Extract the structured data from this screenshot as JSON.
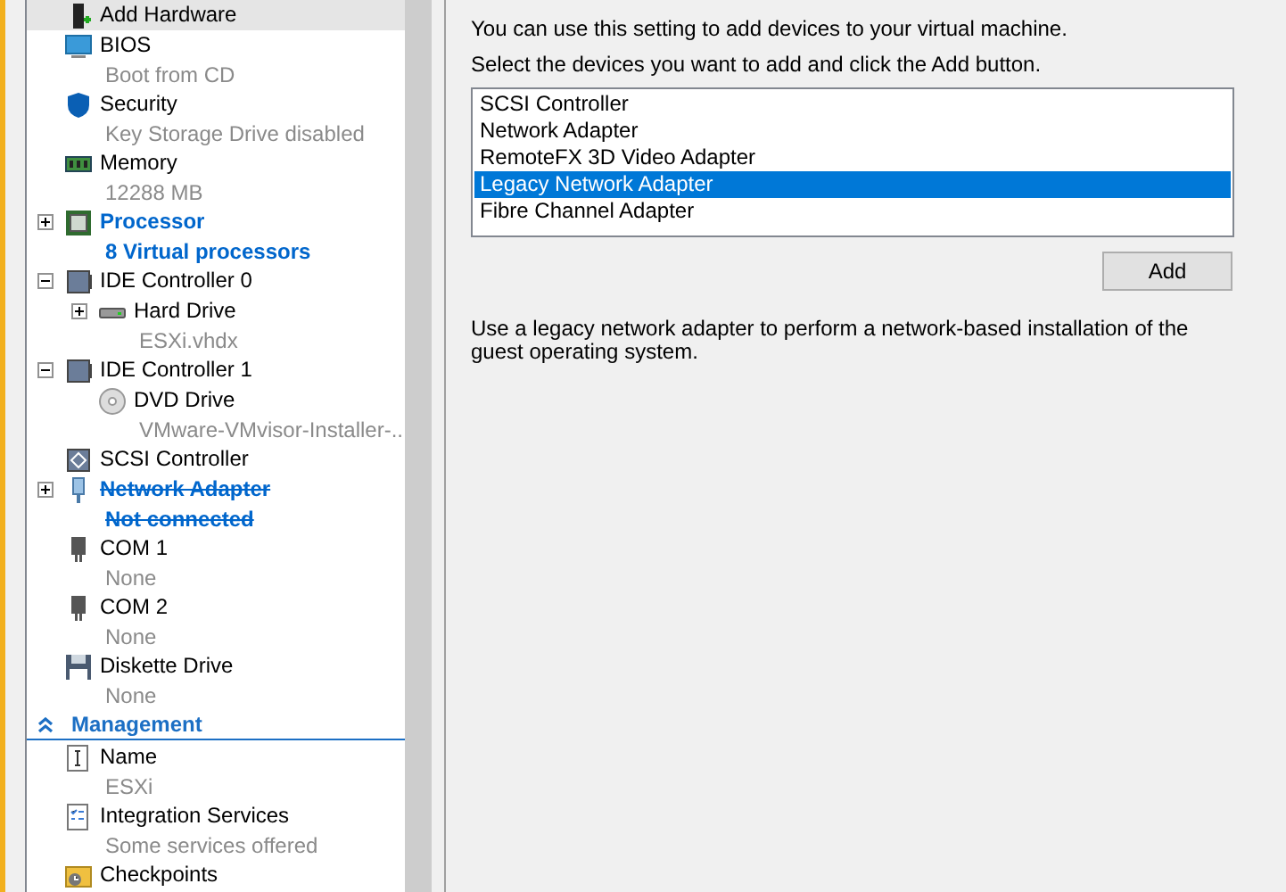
{
  "sidebar": {
    "sections": [
      {
        "items": [
          {
            "title": "Add Hardware",
            "selected": true
          },
          {
            "title": "BIOS",
            "subtitle": "Boot from CD",
            "selected": false
          },
          {
            "title": "Security",
            "subtitle": "Key Storage Drive disabled",
            "selected": false
          },
          {
            "title": "Memory",
            "subtitle": "12288 MB",
            "selected": false
          },
          {
            "title": "Processor",
            "subtitle": "8 Virtual processors",
            "selected": false,
            "emphasized": true,
            "expanded": false
          },
          {
            "title": "IDE Controller 0",
            "selected": false,
            "expanded": true,
            "children": [
              {
                "title": "Hard Drive",
                "subtitle": "ESXi.vhdx",
                "selected": false,
                "expanded": false
              }
            ]
          },
          {
            "title": "IDE Controller 1",
            "selected": false,
            "expanded": true,
            "children": [
              {
                "title": "DVD Drive",
                "subtitle": "VMware-VMvisor-Installer-...",
                "selected": false
              }
            ]
          },
          {
            "title": "SCSI Controller",
            "selected": false
          },
          {
            "title": "Network Adapter",
            "subtitle": "Not connected",
            "selected": false,
            "emphasized": true,
            "removed": true,
            "expanded": false
          },
          {
            "title": "COM 1",
            "subtitle": "None",
            "selected": false
          },
          {
            "title": "COM 2",
            "subtitle": "None",
            "selected": false
          },
          {
            "title": "Diskette Drive",
            "subtitle": "None",
            "selected": false
          }
        ]
      },
      {
        "header": "Management",
        "expanded": true,
        "items": [
          {
            "title": "Name",
            "subtitle": "ESXi",
            "selected": false
          },
          {
            "title": "Integration Services",
            "subtitle": "Some services offered",
            "selected": false
          },
          {
            "title": "Checkpoints",
            "selected": false
          }
        ]
      }
    ]
  },
  "panel": {
    "intro": "You can use this setting to add devices to your virtual machine.",
    "instruction": "Select the devices you want to add and click the Add button.",
    "devices": [
      {
        "label": "SCSI Controller",
        "selected": false
      },
      {
        "label": "Network Adapter",
        "selected": false
      },
      {
        "label": "RemoteFX 3D Video Adapter",
        "selected": false
      },
      {
        "label": "Legacy Network Adapter",
        "selected": true
      },
      {
        "label": "Fibre Channel Adapter",
        "selected": false
      }
    ],
    "button": "Add",
    "description": "Use a legacy network adapter to perform a network-based installation of the guest operating system."
  }
}
